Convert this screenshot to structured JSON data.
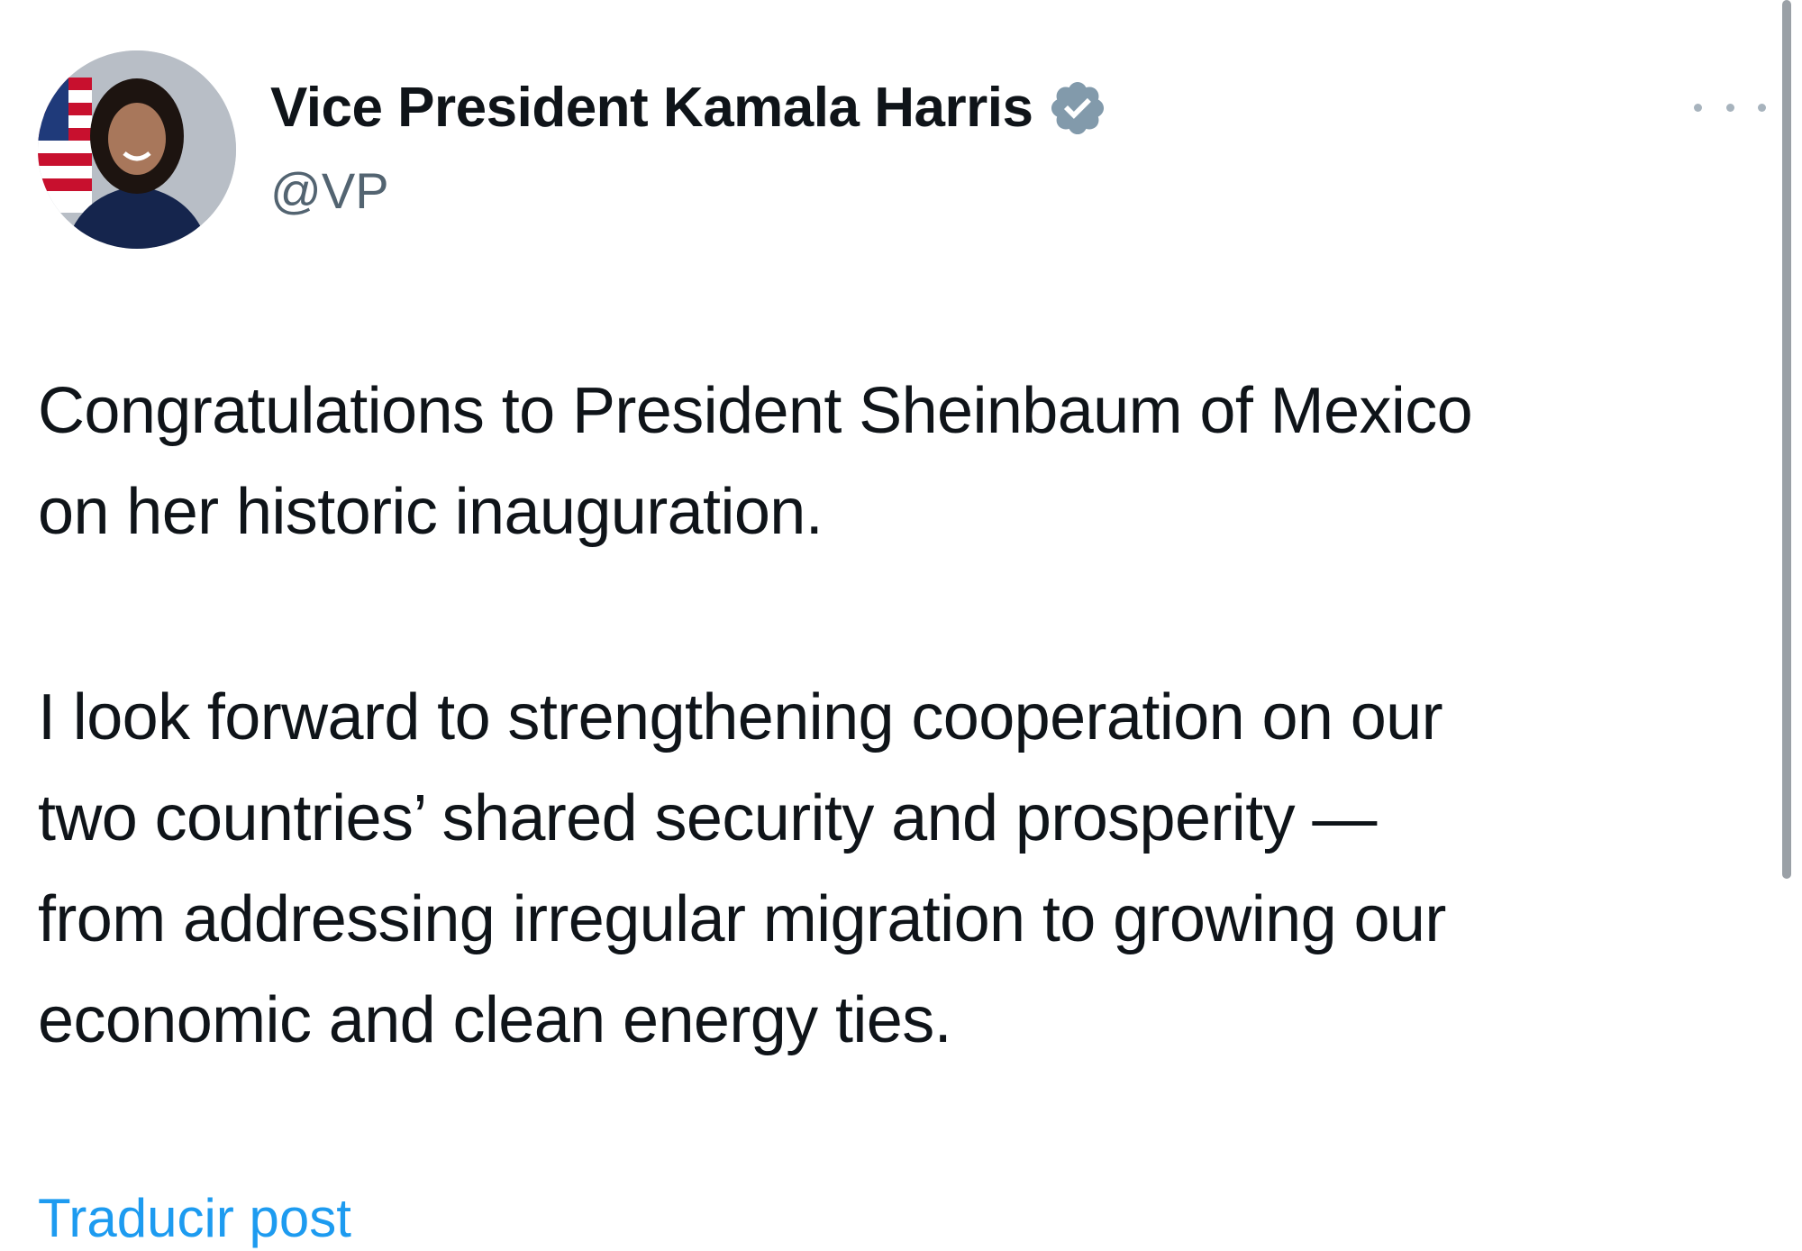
{
  "author": {
    "name": "Vice President Kamala Harris",
    "handle": "@VP",
    "verified_icon": "verified-badge-icon",
    "verified_color": "#829aab"
  },
  "post": {
    "paragraphs": [
      "Congratulations to President Sheinbaum of Mexico\non her historic inauguration.",
      "I look forward to strengthening cooperation on our\ntwo countries’ shared security and prosperity —\nfrom addressing irregular migration to growing our\neconomic and clean energy ties."
    ]
  },
  "actions": {
    "more_icon": "more-options-icon",
    "translate_label": "Traducir post"
  },
  "colors": {
    "text": "#0f1419",
    "secondary": "#536471",
    "link": "#1d9bf0"
  }
}
